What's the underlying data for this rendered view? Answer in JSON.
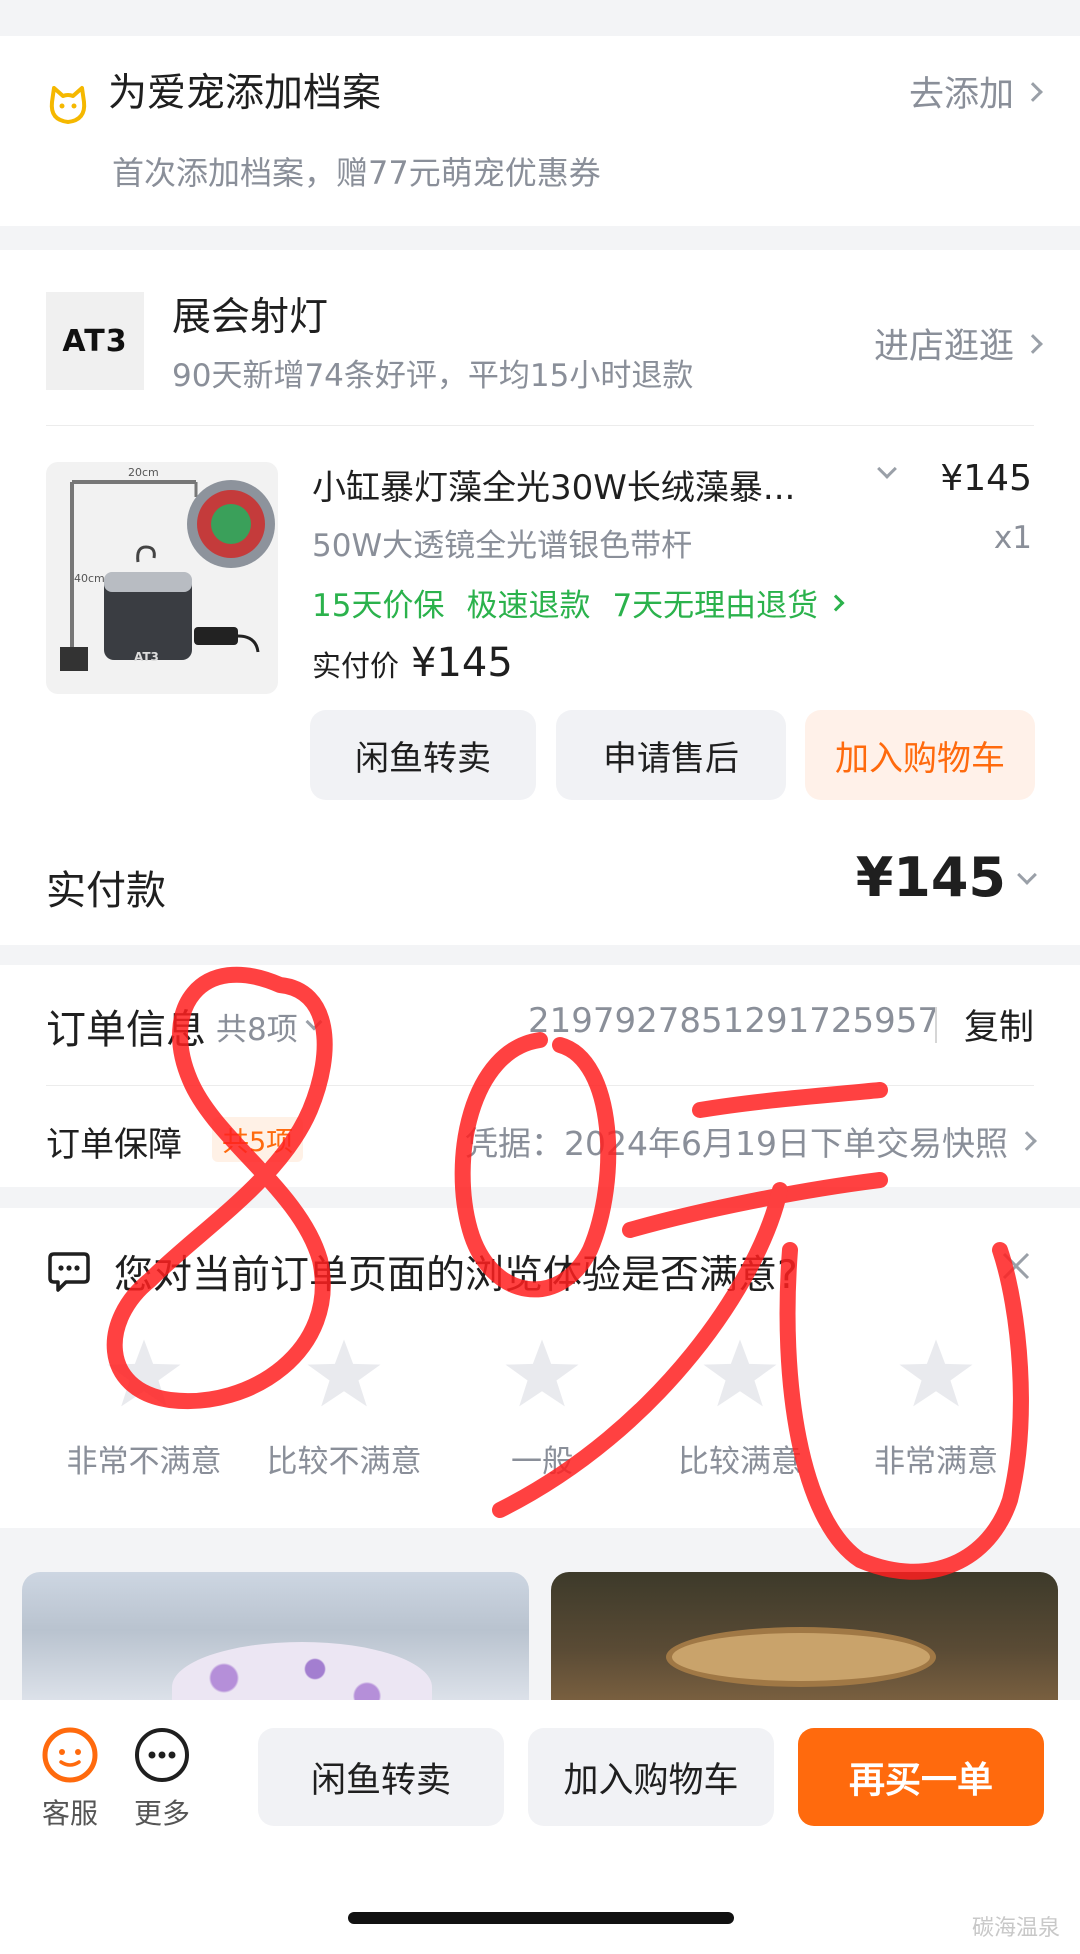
{
  "pet": {
    "title": "为爱宠添加档案",
    "subtitle": "首次添加档案，赠77元萌宠优惠券",
    "action": "去添加"
  },
  "store": {
    "logo_text": "AT3",
    "name": "展会射灯",
    "stats": "90天新增74条好评，平均15小时退款",
    "action": "进店逛逛"
  },
  "product": {
    "title": "小缸暴灯藻全光30W长绒藻暴...",
    "price": "¥145",
    "spec": "50W大透镜全光谱银色带杆",
    "qty": "x1",
    "tags": [
      "15天价保",
      "极速退款",
      "7天无理由退货"
    ],
    "paid_label": "实付价",
    "paid_value": "¥145",
    "image_labels": {
      "width": "20cm",
      "height": "40cm",
      "brand": "AT3"
    }
  },
  "product_actions": {
    "resell": "闲鱼转卖",
    "after_sale": "申请售后",
    "add_cart": "加入购物车"
  },
  "payment": {
    "label": "实付款",
    "value": "¥145"
  },
  "order_info": {
    "label": "订单信息",
    "count": "共8项",
    "order_no": "2197927851291725957",
    "copy": "复制"
  },
  "guarantee": {
    "label": "订单保障",
    "badge": "共5项",
    "snapshot": "凭据：2024年6月19日下单交易快照"
  },
  "survey": {
    "question": "您对当前订单页面的浏览体验是否满意?",
    "options": [
      "非常不满意",
      "比较不满意",
      "一般",
      "比较满意",
      "非常满意"
    ]
  },
  "bottom_bar": {
    "service": "客服",
    "more": "更多",
    "resell": "闲鱼转卖",
    "add_cart": "加入购物车",
    "rebuy": "再买一单"
  },
  "annotation": {
    "handwriting": "80元"
  },
  "watermark": "碳海温泉",
  "colors": {
    "accent_orange": "#ff6a0d",
    "green_tag": "#2bb24c",
    "handwriting_red": "#ff2020"
  }
}
